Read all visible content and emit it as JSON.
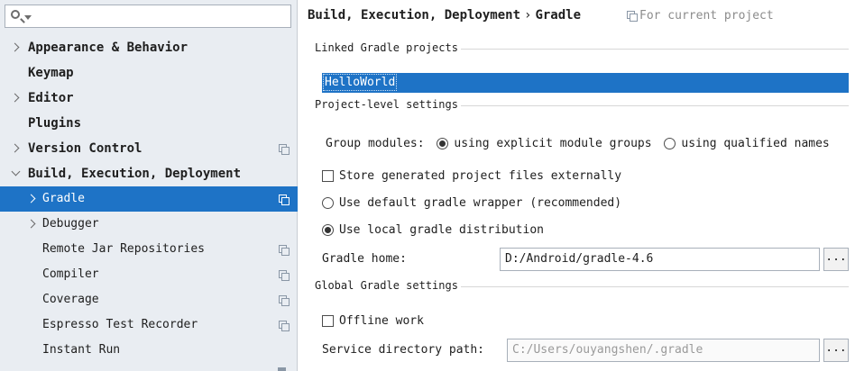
{
  "search": {
    "placeholder": ""
  },
  "sidebar": {
    "items": [
      {
        "label": "Appearance & Behavior"
      },
      {
        "label": "Keymap"
      },
      {
        "label": "Editor"
      },
      {
        "label": "Plugins"
      },
      {
        "label": "Version Control"
      },
      {
        "label": "Build, Execution, Deployment"
      },
      {
        "label": "Gradle"
      },
      {
        "label": "Debugger"
      },
      {
        "label": "Remote Jar Repositories"
      },
      {
        "label": "Compiler"
      },
      {
        "label": "Coverage"
      },
      {
        "label": "Espresso Test Recorder"
      },
      {
        "label": "Instant Run"
      }
    ]
  },
  "breadcrumb": {
    "parent": "Build, Execution, Deployment",
    "separator": "›",
    "current": "Gradle",
    "scope": "For current project"
  },
  "linked": {
    "title": "Linked Gradle projects",
    "projects": [
      "HelloWorld"
    ]
  },
  "project_level": {
    "title": "Project-level settings",
    "group_modules_label": "Group modules:",
    "option_explicit": "using explicit module groups",
    "option_qualified": "using qualified names",
    "store_externally": "Store generated project files externally",
    "default_wrapper": "Use default gradle wrapper (recommended)",
    "local_distribution": "Use local gradle distribution",
    "gradle_home_label": "Gradle home:",
    "gradle_home_value": "D:/Android/gradle-4.6",
    "browse_label": "..."
  },
  "global": {
    "title": "Global Gradle settings",
    "offline_work": "Offline work",
    "service_dir_label": "Service directory path:",
    "service_dir_value": "C:/Users/ouyangshen/.gradle",
    "browse_label": "..."
  },
  "colors": {
    "selection": "#1e73c6",
    "sidebar_bg": "#e9edf2"
  },
  "icons": {
    "search": "search-icon",
    "project_scope": "copy-icon"
  }
}
